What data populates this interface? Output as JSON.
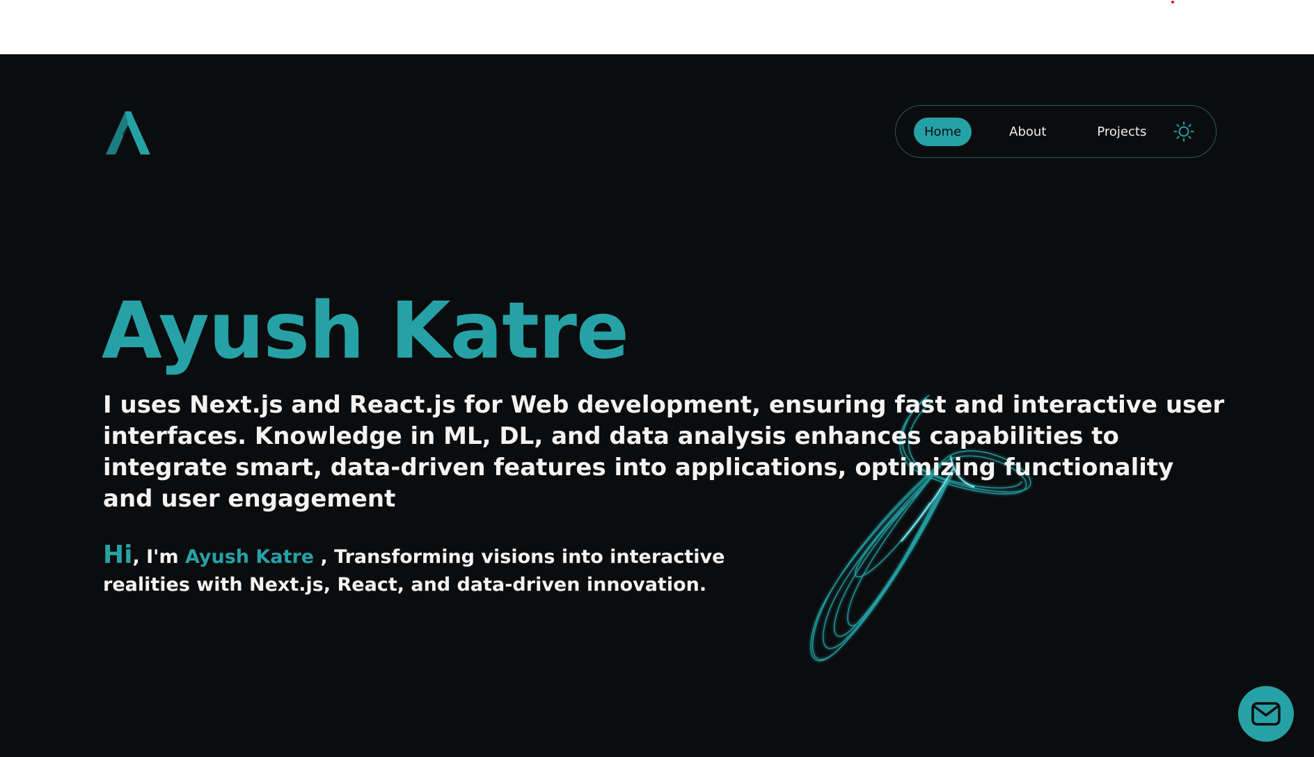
{
  "nav": {
    "items": [
      {
        "label": "Home",
        "active": true
      },
      {
        "label": "About",
        "active": false
      },
      {
        "label": "Projects",
        "active": false
      }
    ],
    "theme_toggle_icon": "sun-icon"
  },
  "logo_icon": "a-monogram-logo-icon",
  "hero": {
    "name": "Ayush Katre",
    "description": "I uses Next.js and React.js for Web development, ensuring fast and interactive user interfaces. Knowledge in ML, DL, and data analysis enhances capabilities to integrate smart, data-driven features into applications, optimizing functionality and user engagement",
    "intro": {
      "greeting": "Hi",
      "im": ", I'm ",
      "name": "Ayush Katre",
      "rest": " , Transforming visions into interactive realities with Next.js, React, and data-driven innovation."
    }
  },
  "contact_button_icon": "mail-icon",
  "colors": {
    "accent": "#26a2a6",
    "background": "#0b0c0e",
    "text": "#f3f3f3",
    "top_bar": "#ffffff"
  }
}
